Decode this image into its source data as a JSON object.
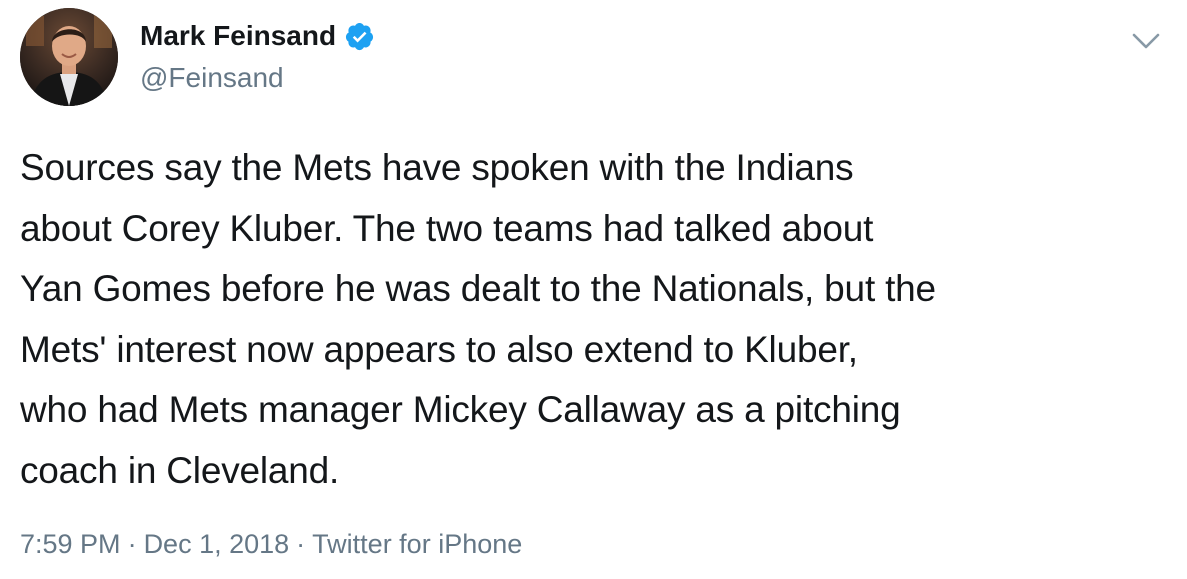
{
  "author": {
    "display_name": "Mark Feinsand",
    "handle": "@Feinsand",
    "verified": true
  },
  "tweet": {
    "text": "Sources say the Mets have spoken with the Indians\nabout Corey Kluber. The two teams had talked about\nYan Gomes before he was dealt to the Nationals, but the\nMets' interest now appears to also extend to Kluber,\nwho had Mets manager Mickey Callaway as a pitching\ncoach in Cleveland."
  },
  "meta": {
    "time": "7:59 PM",
    "separator": "·",
    "date": "Dec 1, 2018",
    "source": "Twitter for iPhone"
  },
  "icons": {
    "verified": "verified-badge-icon",
    "menu": "chevron-down-icon"
  },
  "colors": {
    "verified_blue": "#1da1f2",
    "text": "#14171a",
    "secondary": "#657786"
  }
}
